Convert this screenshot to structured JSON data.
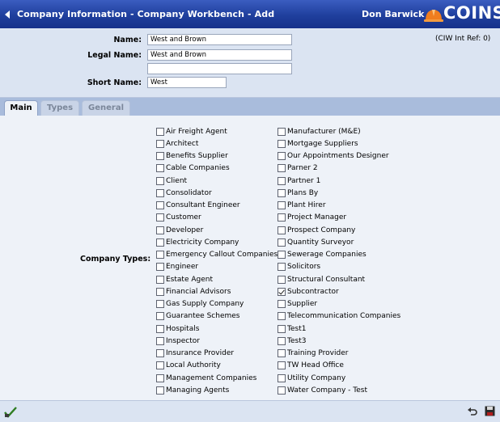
{
  "title_bar": {
    "title": "Company Information - Company Workbench - Add",
    "user": "Don Barwick",
    "logo_text": "COINS",
    "back_icon": "triangle-left",
    "logo_icon": "hard-hat"
  },
  "form": {
    "name_label": "Name:",
    "name_value": "West and Brown",
    "legal_name_label": "Legal Name:",
    "legal_name_value": "West and Brown",
    "legal_name_line2": "",
    "short_name_label": "Short Name:",
    "short_name_value": "West",
    "ciw_ref": "(CIW Int Ref: 0)"
  },
  "tabs": [
    {
      "label": "Main",
      "active": true
    },
    {
      "label": "Types",
      "active": false
    },
    {
      "label": "General",
      "active": false
    }
  ],
  "company_types": {
    "label": "Company Types:",
    "column1": [
      {
        "label": "Air Freight Agent",
        "checked": false
      },
      {
        "label": "Architect",
        "checked": false
      },
      {
        "label": "Benefits Supplier",
        "checked": false
      },
      {
        "label": "Cable Companies",
        "checked": false
      },
      {
        "label": "Client",
        "checked": false
      },
      {
        "label": "Consolidator",
        "checked": false
      },
      {
        "label": "Consultant Engineer",
        "checked": false
      },
      {
        "label": "Customer",
        "checked": false
      },
      {
        "label": "Developer",
        "checked": false
      },
      {
        "label": "Electricity Company",
        "checked": false
      },
      {
        "label": "Emergency Callout Companies",
        "checked": false
      },
      {
        "label": "Engineer",
        "checked": false
      },
      {
        "label": "Estate Agent",
        "checked": false
      },
      {
        "label": "Financial Advisors",
        "checked": false
      },
      {
        "label": "Gas Supply Company",
        "checked": false
      },
      {
        "label": "Guarantee Schemes",
        "checked": false
      },
      {
        "label": "Hospitals",
        "checked": false
      },
      {
        "label": "Inspector",
        "checked": false
      },
      {
        "label": "Insurance Provider",
        "checked": false
      },
      {
        "label": "Local Authority",
        "checked": false
      },
      {
        "label": "Management Companies",
        "checked": false
      },
      {
        "label": "Managing Agents",
        "checked": false
      }
    ],
    "column2": [
      {
        "label": "Manufacturer (M&E)",
        "checked": false
      },
      {
        "label": "Mortgage Suppliers",
        "checked": false
      },
      {
        "label": "Our Appointments Designer",
        "checked": false
      },
      {
        "label": "Parner 2",
        "checked": false
      },
      {
        "label": "Partner 1",
        "checked": false
      },
      {
        "label": "Plans By",
        "checked": false
      },
      {
        "label": "Plant Hirer",
        "checked": false
      },
      {
        "label": "Project Manager",
        "checked": false
      },
      {
        "label": "Prospect Company",
        "checked": false
      },
      {
        "label": "Quantity Surveyor",
        "checked": false
      },
      {
        "label": "Sewerage Companies",
        "checked": false
      },
      {
        "label": "Solicitors",
        "checked": false
      },
      {
        "label": "Structural Consultant",
        "checked": false
      },
      {
        "label": "Subcontractor",
        "checked": true
      },
      {
        "label": "Supplier",
        "checked": false
      },
      {
        "label": "Telecommunication Companies",
        "checked": false
      },
      {
        "label": "Test1",
        "checked": false
      },
      {
        "label": "Test3",
        "checked": false
      },
      {
        "label": "Training Provider",
        "checked": false
      },
      {
        "label": "TW Head Office",
        "checked": false
      },
      {
        "label": "Utility Company",
        "checked": false
      },
      {
        "label": "Water Company - Test",
        "checked": false
      }
    ]
  },
  "footer": {
    "left_icon": "checkmark-tool-icon",
    "undo_icon": "undo-icon",
    "save_icon": "floppy-disk-icon"
  },
  "colors": {
    "title_bar": "#1f3f9d",
    "panel": "#dbe4f2",
    "tab_strip": "#a9bcdc",
    "content": "#eef2f8",
    "logo_accent": "#f07d1e"
  }
}
